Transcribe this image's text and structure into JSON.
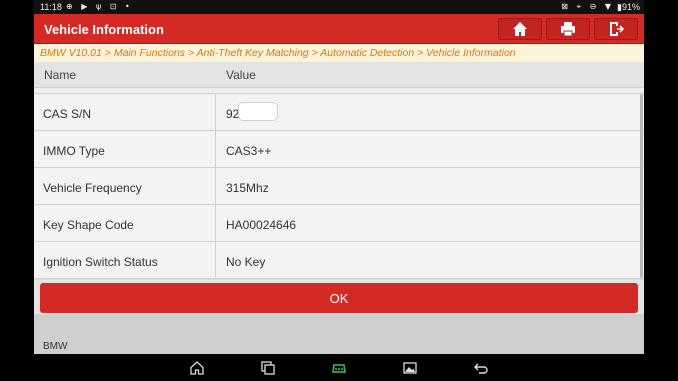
{
  "statusbar": {
    "time": "11:18",
    "left_icons": "⊕ ▶ ψ ⊡ •",
    "right_icons": "⊠ ⌖ ⊖ ▼",
    "battery": "▮91%"
  },
  "header": {
    "title": "Vehicle Information",
    "home_icon": "home-icon",
    "print_icon": "printer-icon",
    "exit_icon": "exit-icon"
  },
  "breadcrumb": "BMW V10.01 > Main Functions  > Anti-Theft Key Matching > Automatic Detection > Vehicle Information",
  "table": {
    "headers": [
      "Name",
      "Value"
    ],
    "rows": [
      {
        "name": "CAS S/N",
        "value": "92"
      },
      {
        "name": "IMMO Type",
        "value": "CAS3++"
      },
      {
        "name": "Vehicle Frequency",
        "value": "315Mhz"
      },
      {
        "name": "Key Shape Code",
        "value": "HA00024646"
      },
      {
        "name": "Ignition Switch Status",
        "value": "No Key"
      }
    ]
  },
  "ok_label": "OK",
  "footer_brand": "BMW",
  "colors": {
    "accent": "#d32a26",
    "breadcrumb_text": "#d47a10",
    "breadcrumb_bg": "#fcf3d9",
    "row_bg": "#f3f3f3"
  }
}
